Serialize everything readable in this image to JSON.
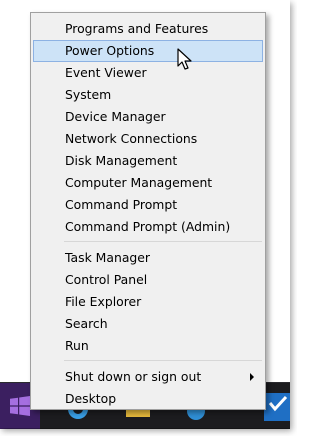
{
  "menu": {
    "groups": [
      {
        "items": [
          {
            "label": "Programs and Features"
          },
          {
            "label": "Power Options",
            "highlighted": true
          },
          {
            "label": "Event Viewer"
          },
          {
            "label": "System"
          },
          {
            "label": "Device Manager"
          },
          {
            "label": "Network Connections"
          },
          {
            "label": "Disk Management"
          },
          {
            "label": "Computer Management"
          },
          {
            "label": "Command Prompt"
          },
          {
            "label": "Command Prompt (Admin)"
          }
        ]
      },
      {
        "items": [
          {
            "label": "Task Manager"
          },
          {
            "label": "Control Panel"
          },
          {
            "label": "File Explorer"
          },
          {
            "label": "Search"
          },
          {
            "label": "Run"
          }
        ]
      },
      {
        "items": [
          {
            "label": "Shut down or sign out",
            "submenu": true
          },
          {
            "label": "Desktop"
          }
        ]
      }
    ]
  },
  "taskbar": {
    "icons": [
      "windows-logo-icon",
      "internet-explorer-icon",
      "file-explorer-icon",
      "store-icon",
      "outlook-icon"
    ]
  },
  "colors": {
    "highlight_bg": "#cde3f7",
    "highlight_border": "#8db2e3",
    "menu_bg": "#f0f0f0",
    "start_tile": "#3b1f60",
    "taskbar": "#1c1c1f"
  }
}
